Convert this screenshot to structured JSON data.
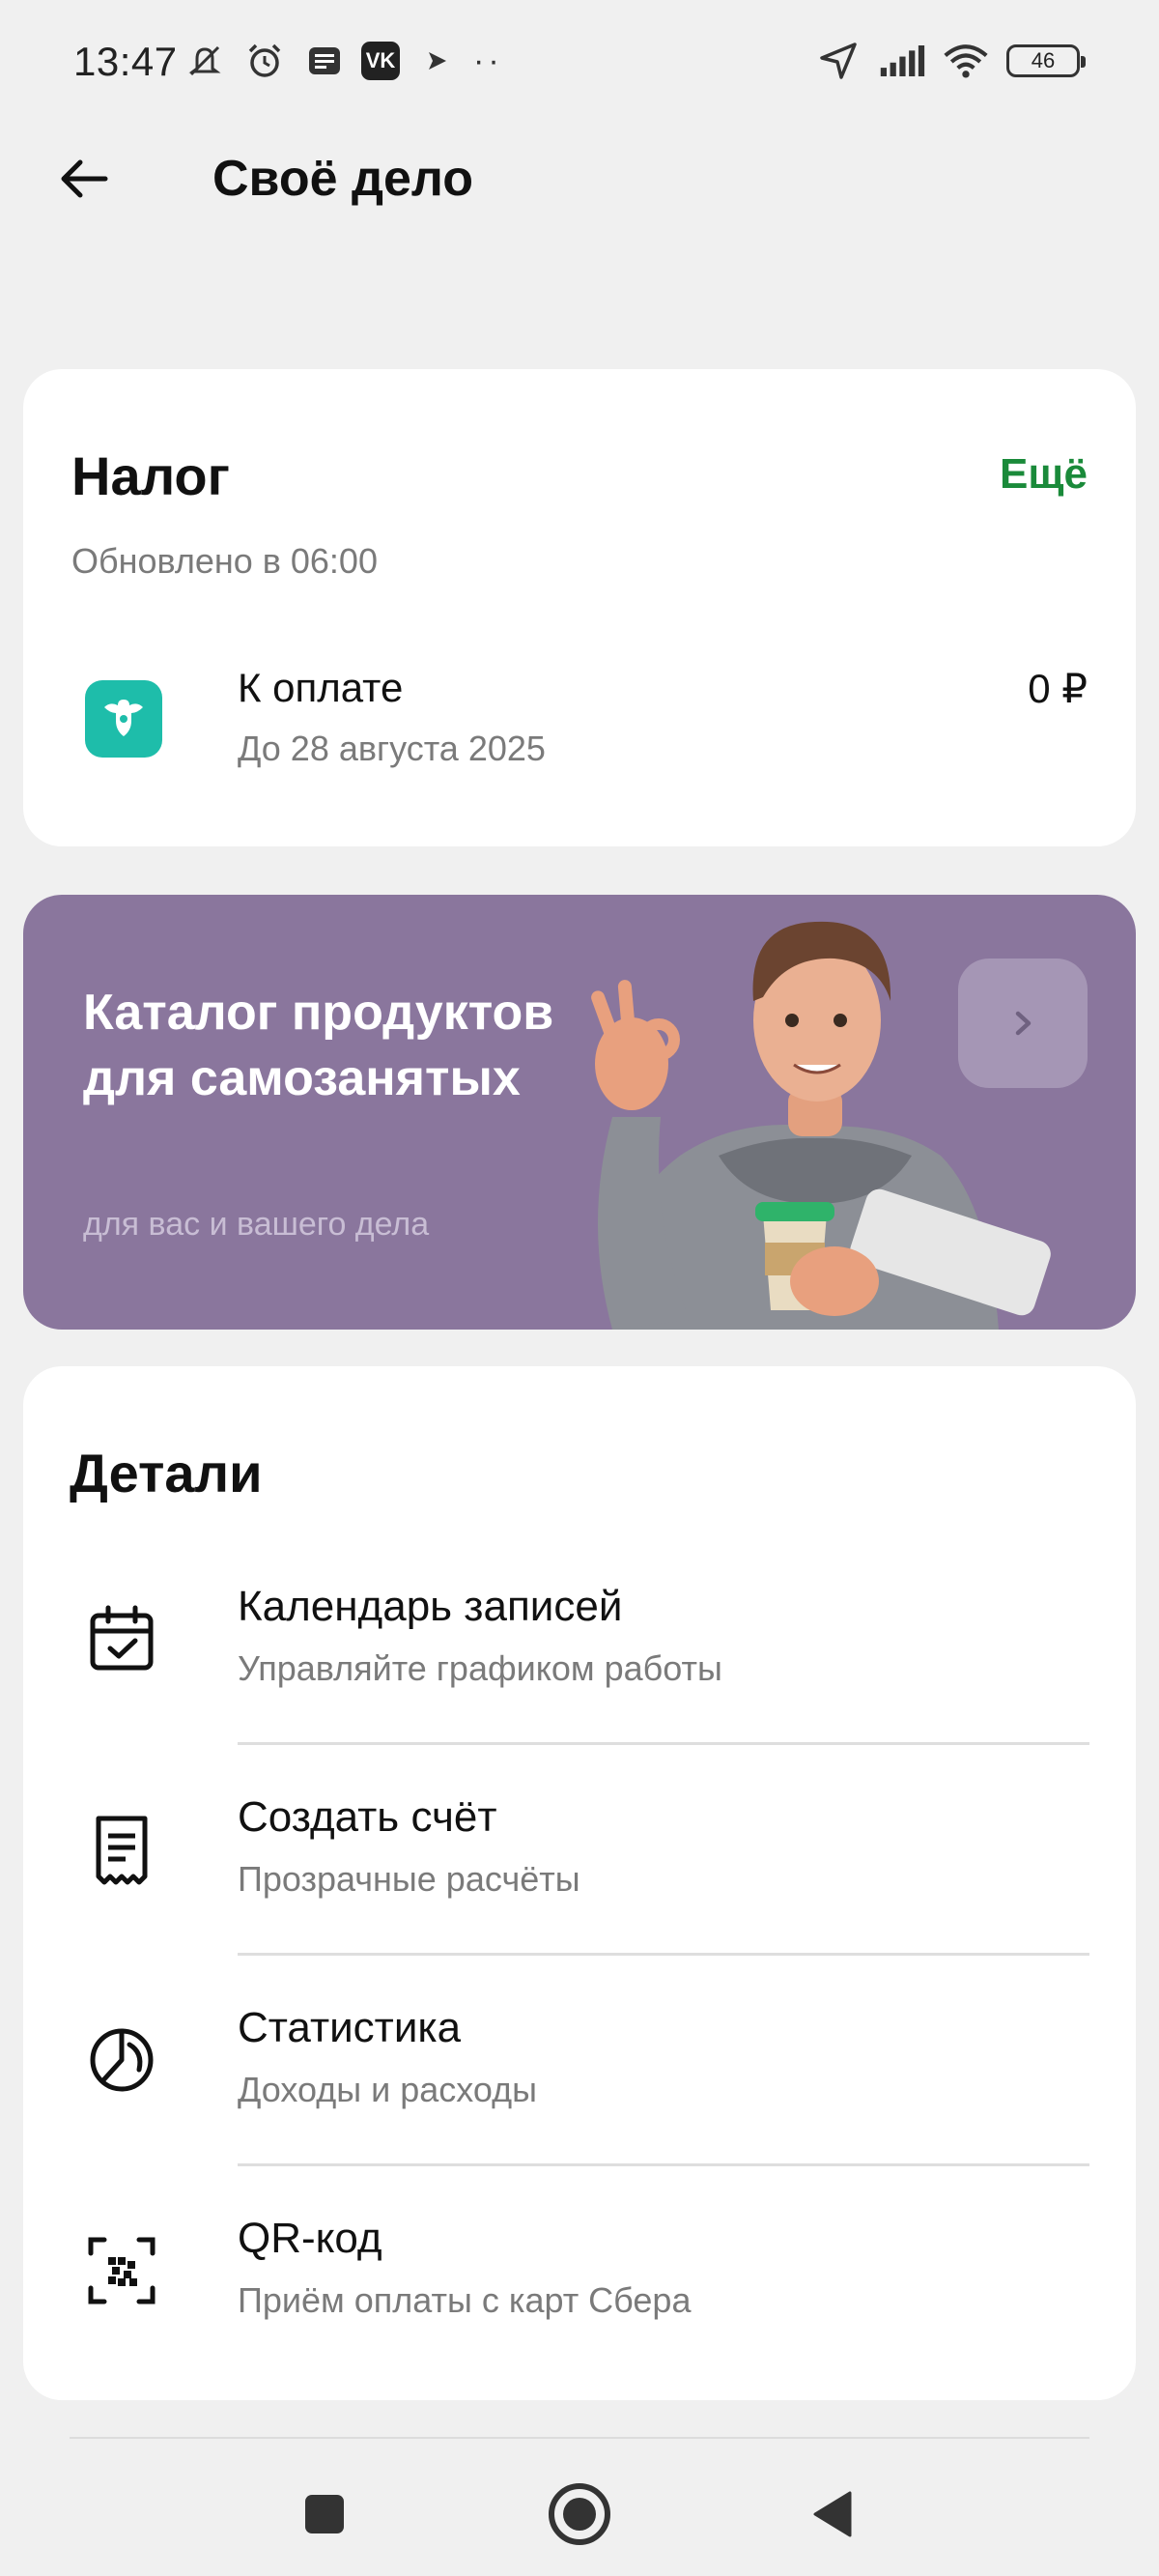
{
  "status_bar": {
    "time": "13:47",
    "left_icons": [
      "mute-icon",
      "alarm-icon",
      "notes-icon",
      "vk-icon",
      "play-icon",
      "more-dots-icon"
    ],
    "vk_label": "VK",
    "dots": "··",
    "right_icons": [
      "location-icon",
      "signal-icon",
      "wifi-icon",
      "battery-icon"
    ],
    "battery_level": "46"
  },
  "header": {
    "title": "Своё дело",
    "back_icon": "arrow-left-icon"
  },
  "tax_card": {
    "title": "Налог",
    "more_label": "Ещё",
    "updated": "Обновлено в 06:00",
    "due_label": "К оплате",
    "due_date": "До 28 августа 2025",
    "amount": "0 ₽",
    "icon": "tax-emblem-icon",
    "accent_color": "#1a8a3a",
    "icon_color": "#1ebdaa"
  },
  "banner": {
    "title": "Каталог продуктов для самозанятых",
    "subtitle": "для вас и вашего дела",
    "background_color": "#8a769d",
    "arrow_icon": "chevron-right-icon"
  },
  "details": {
    "title": "Детали",
    "items": [
      {
        "label": "Календарь записей",
        "subtitle": "Управляйте графиком работы",
        "icon": "calendar-icon"
      },
      {
        "label": "Создать счёт",
        "subtitle": "Прозрачные расчёты",
        "icon": "receipt-icon"
      },
      {
        "label": "Статистика",
        "subtitle": "Доходы и расходы",
        "icon": "pie-chart-icon"
      },
      {
        "label": "QR-код",
        "subtitle": "Приём оплаты с карт Сбера",
        "icon": "qr-code-icon"
      }
    ]
  },
  "nav_bar": {
    "buttons": [
      "recents-square-icon",
      "home-circle-icon",
      "back-triangle-icon"
    ]
  }
}
